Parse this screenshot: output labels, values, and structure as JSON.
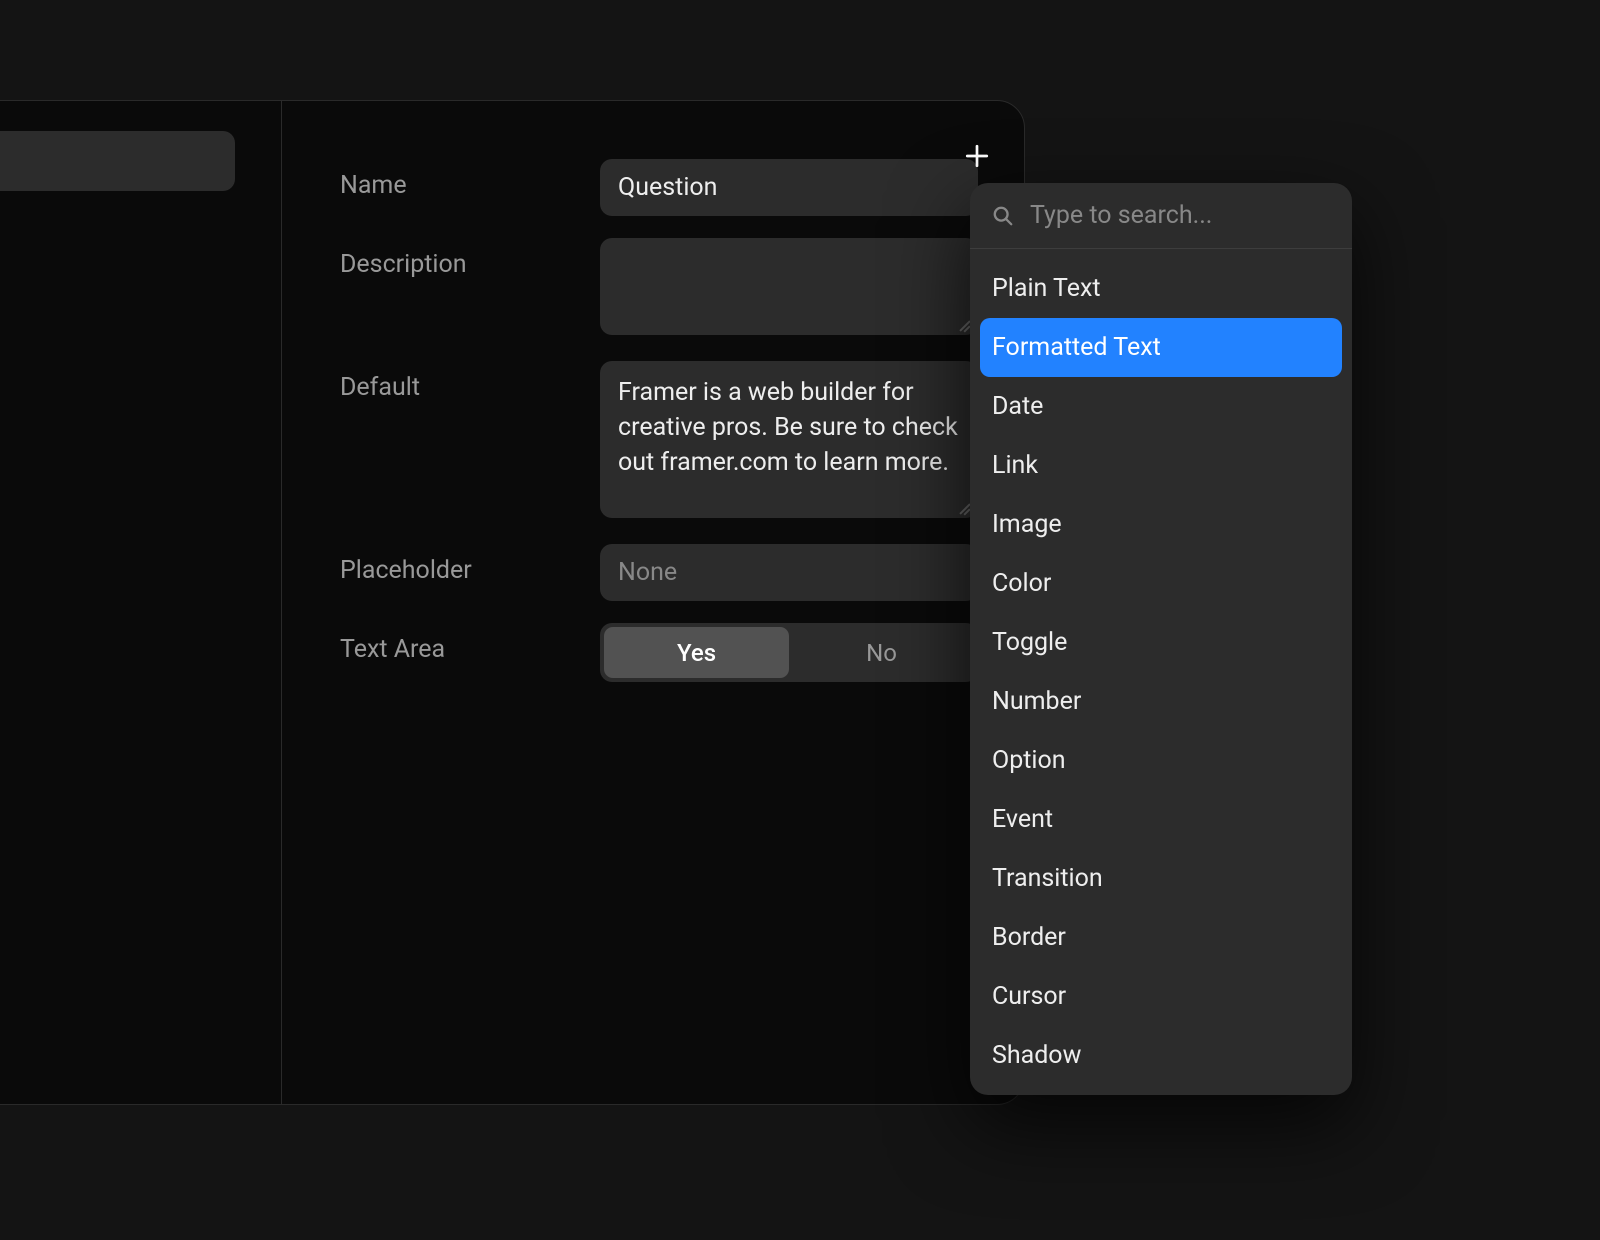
{
  "form": {
    "name": {
      "label": "Name",
      "value": "Question"
    },
    "description": {
      "label": "Description",
      "value": ""
    },
    "default": {
      "label": "Default",
      "value": "Framer is a web builder for creative pros. Be sure to check out framer.com to learn more."
    },
    "placeholder": {
      "label": "Placeholder",
      "value": "",
      "placeholder": "None"
    },
    "textArea": {
      "label": "Text Area",
      "yes": "Yes",
      "no": "No"
    }
  },
  "dropdown": {
    "searchPlaceholder": "Type to search...",
    "items": [
      "Plain Text",
      "Formatted Text",
      "Date",
      "Link",
      "Image",
      "Color",
      "Toggle",
      "Number",
      "Option",
      "Event",
      "Transition",
      "Border",
      "Cursor",
      "Shadow"
    ],
    "selectedIndex": 1
  }
}
